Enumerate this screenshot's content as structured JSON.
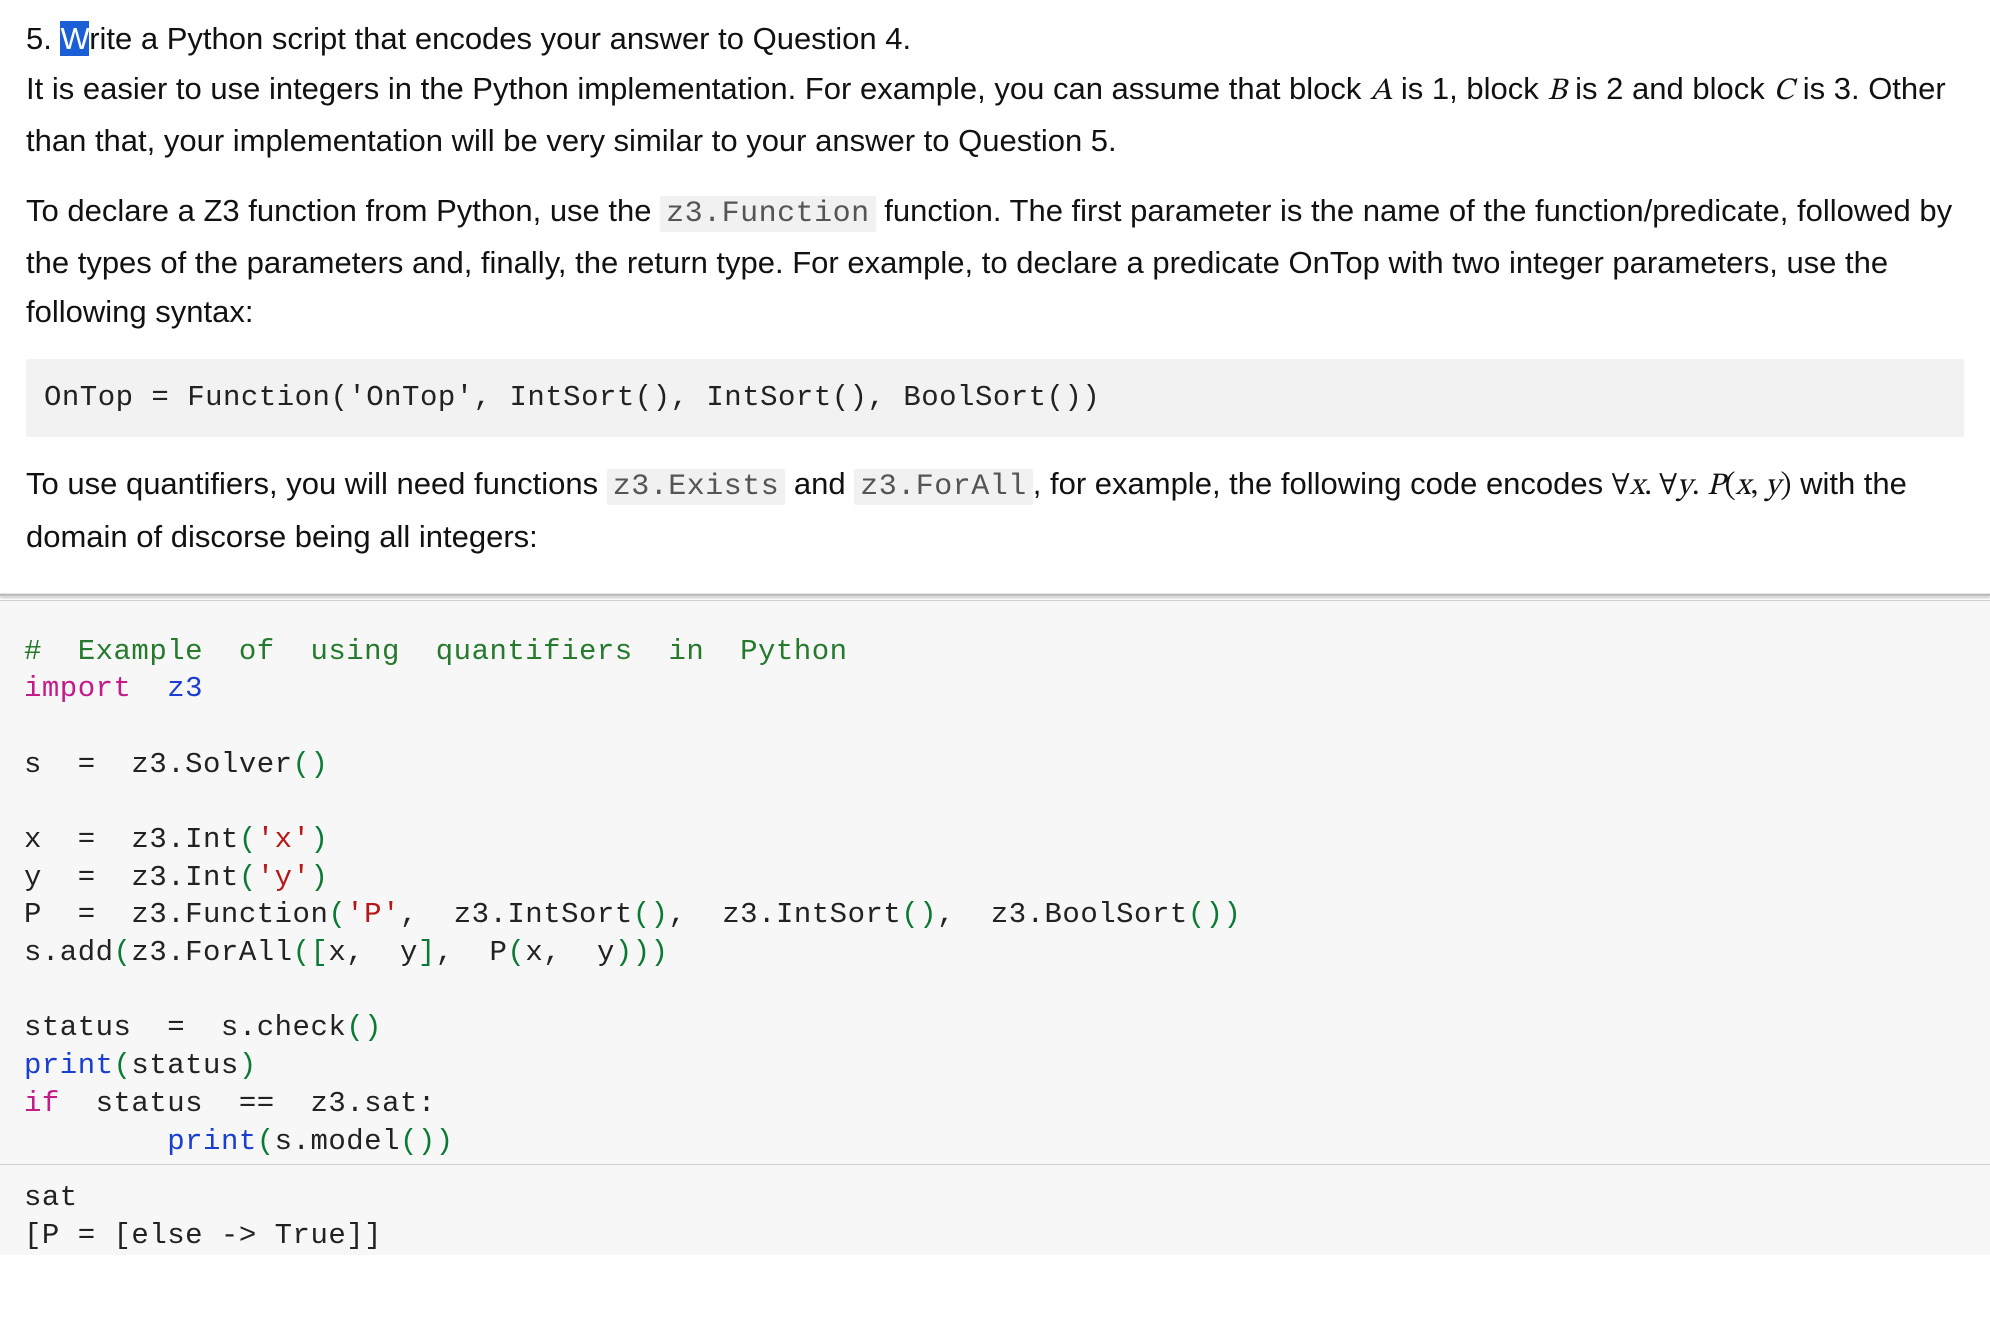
{
  "question": {
    "number": "5.",
    "first_char": "W",
    "first_line_rest": "rite a Python script that encodes your answer to Question 4.",
    "para1_a": "It is easier to use integers in the Python implementation. For example, you can assume that block ",
    "sym_A": "A",
    "para1_b": " is 1, block ",
    "sym_B": "B",
    "para1_c": " is 2 and block ",
    "sym_C": "C",
    "para1_d": " is 3. Other than that, your implementation will be very similar to your answer to Question 5.",
    "para2_a": "To declare a Z3 function from Python, use the ",
    "code_func": "z3.Function",
    "para2_b": " function. The first parameter is the name of the function/predicate, followed by the types of the parameters and, finally, the return type. For example, to declare a predicate OnTop with two integer parameters, use the following syntax:",
    "ontop_code": "OnTop  =  Function('OnTop',  IntSort(),  IntSort(),  BoolSort())",
    "para3_a": "To use quantifiers, you will need functions ",
    "code_exists": "z3.Exists",
    "para3_b": " and ",
    "code_forall": "z3.ForAll",
    "para3_c": ", for example, the following code encodes ",
    "math_forall1": "∀",
    "math_x": "x",
    "math_dot": ". ",
    "math_forall2": "∀",
    "math_y": "y",
    "math_P": "P",
    "math_open": "(",
    "math_comma": ", ",
    "math_close": ")",
    "para3_d": " with the domain of discorse being all integers:"
  },
  "code": {
    "c1": "#  Example  of  using  quantifiers  in  Python",
    "c2_kw": "import",
    "c2_mod": "z3",
    "c3_a": "s  =  z3.Solver",
    "c3_par": "()",
    "c4_a": "x  =  z3.Int",
    "c4_p1": "(",
    "c4_s": "'x'",
    "c4_p2": ")",
    "c5_a": "y  =  z3.Int",
    "c5_p1": "(",
    "c5_s": "'y'",
    "c5_p2": ")",
    "c6_a": "P  =  z3.Function",
    "c6_p1": "(",
    "c6_s": "'P'",
    "c6_b": ",  z3.IntSort",
    "c6_p2": "()",
    "c6_c": ",  z3.IntSort",
    "c6_p3": "()",
    "c6_d": ",  z3.BoolSort",
    "c6_p4": "())",
    "c7_a": "s.add",
    "c7_p1": "(",
    "c7_b": "z3.ForAll",
    "c7_p2": "([",
    "c7_c": "x,  y",
    "c7_p3": "]",
    "c7_d": ",  P",
    "c7_p4": "(",
    "c7_e": "x,  y",
    "c7_p5": ")))",
    "c8_a": "status  =  s.check",
    "c8_par": "()",
    "c9_func": "print",
    "c9_p1": "(",
    "c9_b": "status",
    "c9_p2": ")",
    "c10_kw": "if",
    "c10_a": "  status  ==  z3.sat:",
    "c11_pad": "        ",
    "c11_func": "print",
    "c11_p1": "(",
    "c11_b": "s.model",
    "c11_p2": "())"
  },
  "output": {
    "o1": "sat",
    "o2": "[P = [else -> True]]"
  }
}
